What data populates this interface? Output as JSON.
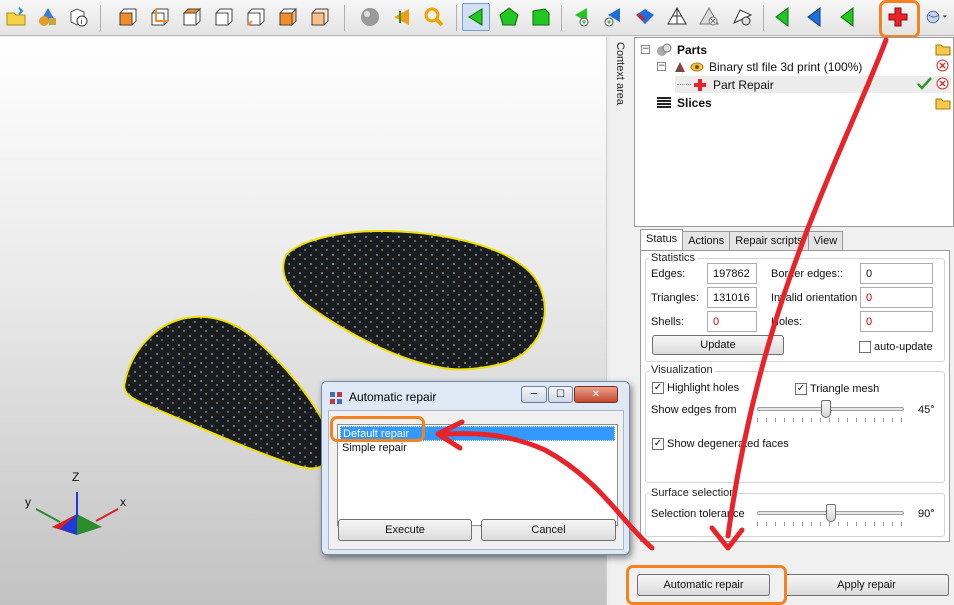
{
  "toolbar": {
    "icons": [
      "open-folder-icon",
      "add-shapes-icon",
      "part-info-icon",
      "view-front-icon",
      "view-back-icon",
      "view-top-icon",
      "view-bottom-icon",
      "view-left-icon",
      "view-right-icon",
      "material-sphere-icon",
      "cut-cone-icon",
      "zoom-icon",
      "select-triangle-icon",
      "select-surface-icon",
      "select-shell-icon",
      "add-triangle-icon",
      "add-point-icon",
      "triangle-paint-icon",
      "wireframe-icon",
      "delete-triangle-icon",
      "delete-point-icon",
      "flip-normal-icon",
      "triangle-blue-icon",
      "triangle-green-icon",
      "part-repair-icon",
      "sphere-dropdown-icon"
    ]
  },
  "context_area": {
    "label": "Context area"
  },
  "tree": {
    "parts_label": "Parts",
    "file_label": "Binary stl file 3d print (100%)",
    "repair_label": "Part Repair",
    "slices_label": "Slices"
  },
  "panel": {
    "tabs": [
      "Status",
      "Actions",
      "Repair scripts",
      "View"
    ],
    "statistics": {
      "title": "Statistics",
      "edges_label": "Edges:",
      "edges_value": "197862",
      "triangles_label": "Triangles:",
      "triangles_value": "131016",
      "shells_label": "Shells:",
      "shells_value": "0",
      "border_label": "Border edges::",
      "border_value": "0",
      "invalid_label": "Invalid orientation",
      "invalid_value": "0",
      "holes_label": "Holes:",
      "holes_value": "0",
      "update_label": "Update",
      "autoupdate_label": "auto-update"
    },
    "visualization": {
      "title": "Visualization",
      "highlight_holes": "Highlight holes",
      "triangle_mesh": "Triangle mesh",
      "show_edges_from": "Show edges from",
      "edges_angle": "45°",
      "edges_fraction": 0.47,
      "degenerated": "Show degenerated faces"
    },
    "surface": {
      "title": "Surface selection",
      "tolerance_label": "Selection tolerance",
      "tolerance_value": "90°",
      "tolerance_fraction": 0.5
    }
  },
  "buttons": {
    "automatic_repair": "Automatic repair",
    "apply_repair": "Apply repair"
  },
  "dialog": {
    "title": "Automatic repair",
    "items": [
      "Default repair",
      "Simple repair"
    ],
    "execute": "Execute",
    "cancel": "Cancel"
  },
  "axes": {
    "x": "x",
    "y": "y",
    "z": "Z"
  },
  "colors": {
    "accent_orange": "#f58220",
    "arrow_red": "#e8232a",
    "mesh_outline": "#f0e000"
  }
}
